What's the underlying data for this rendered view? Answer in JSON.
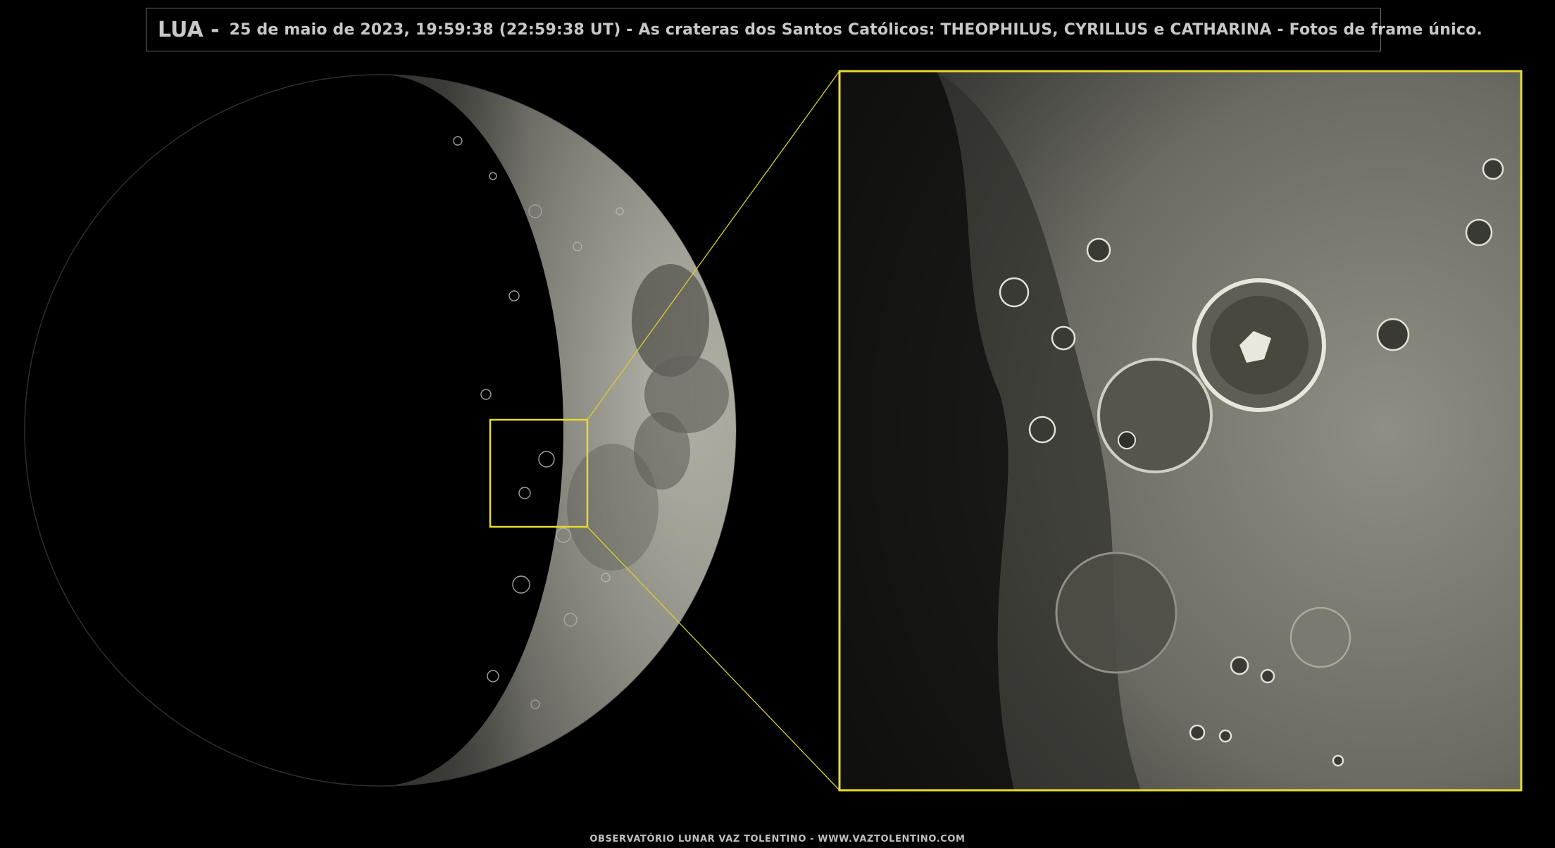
{
  "header": {
    "object": "LUA -",
    "text": "25 de maio de 2023, 19:59:38 (22:59:38 UT)  -  As crateras dos Santos Católicos:  THEOPHILUS, CYRILLUS e CATHARINA  -  Fotos de frame único."
  },
  "footer": {
    "credit": "OBSERVATÓRIO LUNAR VAZ TOLENTINO   -   WWW.VAZTOLENTINO.COM"
  },
  "colors": {
    "background": "#000000",
    "highlight": "#e6dc2a",
    "title_text": "#c8c8c8"
  }
}
